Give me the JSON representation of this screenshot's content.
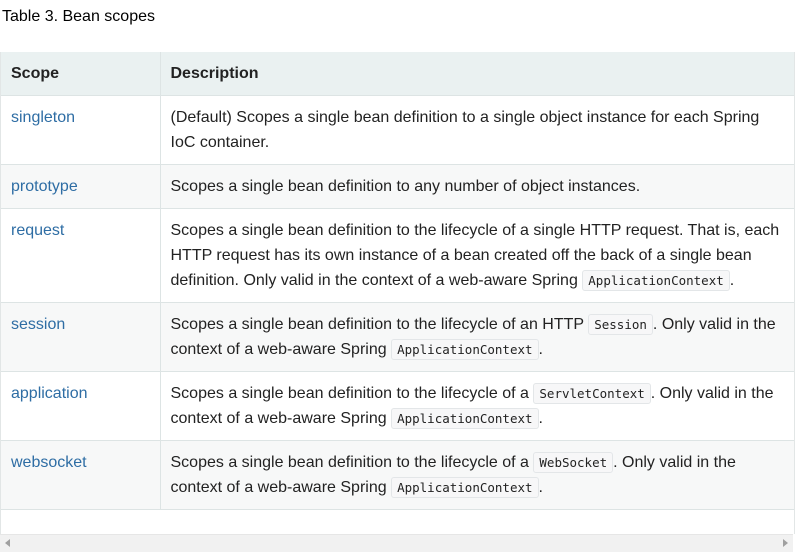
{
  "caption": "Table 3. Bean scopes",
  "table": {
    "headers": {
      "scope": "Scope",
      "description": "Description"
    },
    "rows": [
      {
        "scope": "singleton",
        "description": [
          {
            "text": "(Default) Scopes a single bean definition to a single object instance for each Spring IoC container."
          }
        ]
      },
      {
        "scope": "prototype",
        "description": [
          {
            "text": "Scopes a single bean definition to any number of object instances."
          }
        ]
      },
      {
        "scope": "request",
        "description": [
          {
            "text": "Scopes a single bean definition to the lifecycle of a single HTTP request. That is, each HTTP request has its own instance of a bean created off the back of a single bean definition. Only valid in the context of a web-aware Spring "
          },
          {
            "code": "ApplicationContext"
          },
          {
            "text": "."
          }
        ]
      },
      {
        "scope": "session",
        "description": [
          {
            "text": "Scopes a single bean definition to the lifecycle of an HTTP "
          },
          {
            "code": "Session"
          },
          {
            "text": ". Only valid in the context of a web-aware Spring "
          },
          {
            "code": "ApplicationContext"
          },
          {
            "text": "."
          }
        ]
      },
      {
        "scope": "application",
        "description": [
          {
            "text": "Scopes a single bean definition to the lifecycle of a "
          },
          {
            "code": "ServletContext"
          },
          {
            "text": ". Only valid in the context of a web-aware Spring "
          },
          {
            "code": "ApplicationContext"
          },
          {
            "text": "."
          }
        ]
      },
      {
        "scope": "websocket",
        "description": [
          {
            "text": "Scopes a single bean definition to the lifecycle of a "
          },
          {
            "code": "WebSocket"
          },
          {
            "text": ". Only valid in the context of a web-aware Spring "
          },
          {
            "code": "ApplicationContext"
          },
          {
            "text": "."
          }
        ]
      }
    ]
  },
  "scrollbar": {
    "left_icon": "arrow-left-icon",
    "right_icon": "arrow-right-icon"
  },
  "colors": {
    "link": "#2e6da4",
    "header_bg": "#eaf1f1",
    "stripe_bg": "#f7f8f8"
  }
}
